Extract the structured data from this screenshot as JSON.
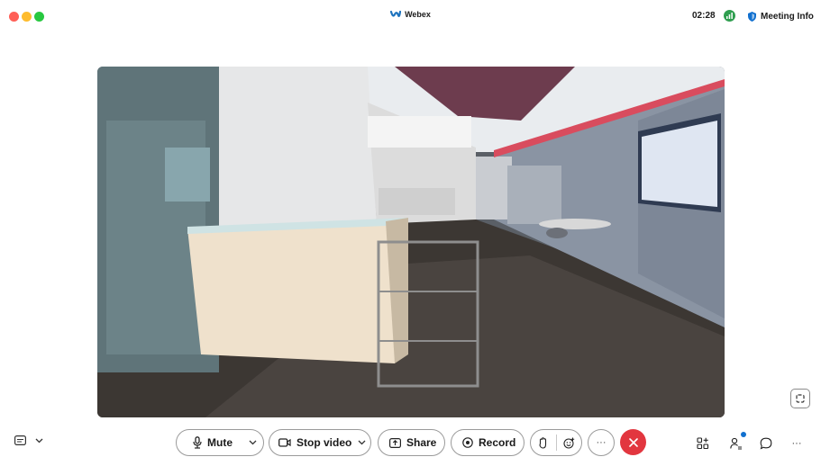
{
  "window": {
    "title": "Webex"
  },
  "status": {
    "timer": "02:28",
    "meeting_info_label": "Meeting Info"
  },
  "colors": {
    "end_call": "#e2363f",
    "accent": "#1170cf",
    "signal": "#2f9e4f"
  },
  "icons": {
    "app_logo": "webex-logo-icon",
    "signal": "network-signal-icon",
    "meeting_info": "shield-icon",
    "pip": "picture-in-picture-icon",
    "captions": "closed-captions-icon",
    "mute": "microphone-icon",
    "video": "camera-icon",
    "share": "share-screen-icon",
    "record": "record-icon",
    "raise_hand": "raise-hand-icon",
    "reactions": "emoji-icon",
    "more": "more-options-icon",
    "end": "close-icon",
    "apps": "apps-icon",
    "participants": "participants-icon",
    "chat": "chat-icon",
    "overflow": "more-options-icon"
  },
  "toolbar": {
    "mute_label": "Mute",
    "video_label": "Stop video",
    "share_label": "Share",
    "record_label": "Record",
    "more_label": "···",
    "overflow_label": "···"
  }
}
